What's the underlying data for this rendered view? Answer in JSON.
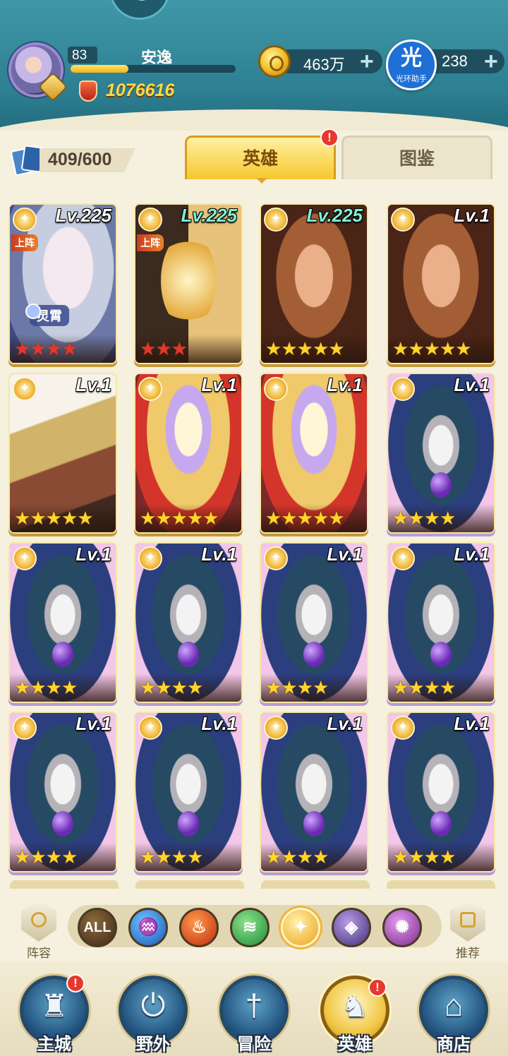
{
  "player": {
    "level": "83",
    "name": "安逸",
    "xp_fraction": 0.35,
    "power": "1076616"
  },
  "resources": {
    "coins": "463万",
    "gems": "238",
    "helper_char": "光",
    "helper_label": "光环助手"
  },
  "roster": {
    "count": "409/600"
  },
  "tabs": [
    {
      "label": "英雄",
      "active": true,
      "alert": "!"
    },
    {
      "label": "图鉴",
      "active": false
    }
  ],
  "heroes": [
    {
      "level": "Lv.225",
      "level_style": "white",
      "deployed": "上阵",
      "title": "灵霄",
      "stars": 4,
      "star_color": "red",
      "art": "white",
      "frame": "gold"
    },
    {
      "level": "Lv.225",
      "level_style": "teal",
      "deployed": "上阵",
      "stars": 3,
      "star_color": "red",
      "art": "twins",
      "frame": "gold"
    },
    {
      "level": "Lv.225",
      "level_style": "teal",
      "stars": 5,
      "star_color": "gold",
      "art": "wild",
      "frame": "gold"
    },
    {
      "level": "Lv.1",
      "level_style": "white",
      "stars": 5,
      "star_color": "gold",
      "art": "wild",
      "frame": "gold"
    },
    {
      "level": "Lv.1",
      "level_style": "white",
      "stars": 5,
      "star_color": "gold",
      "art": "king",
      "frame": "gold"
    },
    {
      "level": "Lv.1",
      "level_style": "white",
      "stars": 5,
      "star_color": "gold",
      "art": "red",
      "frame": "gold"
    },
    {
      "level": "Lv.1",
      "level_style": "white",
      "stars": 5,
      "star_color": "gold",
      "art": "red",
      "frame": "gold"
    },
    {
      "level": "Lv.1",
      "level_style": "white",
      "stars": 4,
      "star_color": "gold",
      "art": "wizard",
      "frame": "purple"
    },
    {
      "level": "Lv.1",
      "level_style": "white",
      "stars": 4,
      "star_color": "gold",
      "art": "wizard",
      "frame": "purple"
    },
    {
      "level": "Lv.1",
      "level_style": "white",
      "stars": 4,
      "star_color": "gold",
      "art": "wizard",
      "frame": "purple"
    },
    {
      "level": "Lv.1",
      "level_style": "white",
      "stars": 4,
      "star_color": "gold",
      "art": "wizard",
      "frame": "purple"
    },
    {
      "level": "Lv.1",
      "level_style": "white",
      "stars": 4,
      "star_color": "gold",
      "art": "wizard",
      "frame": "purple"
    },
    {
      "level": "Lv.1",
      "level_style": "white",
      "stars": 4,
      "star_color": "gold",
      "art": "wizard",
      "frame": "purple"
    },
    {
      "level": "Lv.1",
      "level_style": "white",
      "stars": 4,
      "star_color": "gold",
      "art": "wizard",
      "frame": "purple"
    },
    {
      "level": "Lv.1",
      "level_style": "white",
      "stars": 4,
      "star_color": "gold",
      "art": "wizard",
      "frame": "purple"
    },
    {
      "level": "Lv.1",
      "level_style": "white",
      "stars": 4,
      "star_color": "gold",
      "art": "wizard",
      "frame": "purple"
    }
  ],
  "filters": {
    "left_label": "阵容",
    "right_label": "推荐",
    "all_label": "ALL",
    "elements": [
      "all",
      "water",
      "fire",
      "wind",
      "light",
      "dark",
      "arcane"
    ],
    "selected": "light"
  },
  "nav": [
    {
      "label": "主城",
      "icon": "castle-icon",
      "alert": "!"
    },
    {
      "label": "野外",
      "icon": "portal-icon"
    },
    {
      "label": "冒险",
      "icon": "sword-icon"
    },
    {
      "label": "英雄",
      "icon": "helmet-icon",
      "active": true,
      "alert": "!"
    },
    {
      "label": "商店",
      "icon": "shop-icon"
    }
  ],
  "alert_mark": "!"
}
